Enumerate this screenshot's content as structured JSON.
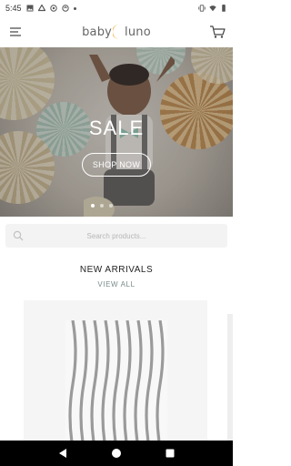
{
  "status_bar": {
    "time": "5:45",
    "icons": [
      "photo-icon",
      "drive-icon",
      "circle-icon",
      "sync-icon",
      "dot-icon",
      "vibrate-icon",
      "wifi-icon",
      "battery-icon"
    ]
  },
  "header": {
    "logo_left": "baby",
    "logo_right": "luno",
    "menu_icon": "hamburger-icon",
    "cart_icon": "cart-icon"
  },
  "hero": {
    "title": "SALE",
    "cta_label": "SHOP NOW",
    "slide_count": 3,
    "active_slide": 1
  },
  "search": {
    "placeholder": "Search products..."
  },
  "new_arrivals": {
    "title": "NEW ARRIVALS",
    "view_all_label": "VIEW ALL"
  },
  "nav_bar": {
    "back": "back-icon",
    "home": "home-icon",
    "recents": "recents-icon"
  },
  "colors": {
    "accent_moon": "#e8b44a",
    "logo_text": "#666666",
    "view_all": "#7a8a8a",
    "nav_bg": "#000000"
  }
}
